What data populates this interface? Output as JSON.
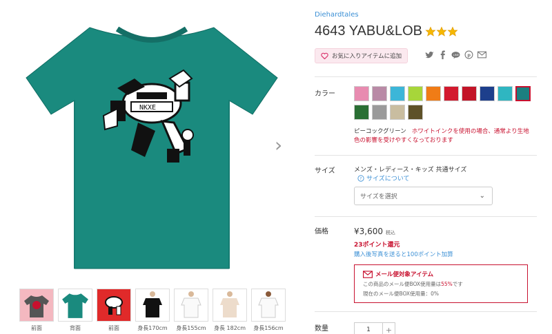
{
  "product": {
    "brand": "Diehardtales",
    "title": "4643 YABU&LOB",
    "favorite_label": "お気に入りアイテムに追加",
    "share_icons": [
      "twitter-icon",
      "facebook-icon",
      "line-icon",
      "pinterest-icon",
      "mail-icon"
    ]
  },
  "color_section": {
    "label": "カラー",
    "swatches": [
      "#e88bb0",
      "#b98aa6",
      "#3cb6d8",
      "#a7d63a",
      "#f07c16",
      "#d3192e",
      "#c31428",
      "#1d3f8c",
      "#2fb6c1",
      "#1b8080",
      "#2a6f34",
      "#9a9a9a",
      "#c9bda0",
      "#5e5128"
    ],
    "selected_index": 9,
    "selected_name": "ピーコックグリーン",
    "warning": "ホワイトインクを使用の場合、通常より生地色の影響を受けやすくなっております"
  },
  "size_section": {
    "label": "サイズ",
    "description": "メンズ・レディース・キッズ 共通サイズ",
    "about_link": "サイズについて",
    "select_placeholder": "サイズを選択"
  },
  "price_section": {
    "label": "価格",
    "price": "¥3,600",
    "tax_note": "税込",
    "points": "23ポイント還元",
    "points_link": "購入後写真を送ると100ポイント加算"
  },
  "mail_box": {
    "title": "メール便対象アイテム",
    "line1_prefix": "この商品のメール便BOX使用量は",
    "line1_pct": "55%",
    "line1_suffix": "です",
    "line2": "現在のメール便BOX使用量：0%"
  },
  "quantity_section": {
    "label": "数量",
    "value": "1",
    "plus": "+"
  },
  "thumbnails": [
    {
      "caption": "前面",
      "bg": "#f4b8c0"
    },
    {
      "caption": "背面",
      "bg": "#1a8a7e"
    },
    {
      "caption": "前面",
      "bg": "#e02a2a"
    },
    {
      "caption": "身長170cm",
      "bg": "#ffffff"
    },
    {
      "caption": "身長155cm",
      "bg": "#ffffff"
    },
    {
      "caption": "身長 182cm",
      "bg": "#ffffff"
    },
    {
      "caption": "身長156cm",
      "bg": "#ffffff"
    }
  ],
  "colors": {
    "accent_red": "#c8102e",
    "link_blue": "#3a8fd5",
    "shirt_green": "#1a8a7e"
  }
}
